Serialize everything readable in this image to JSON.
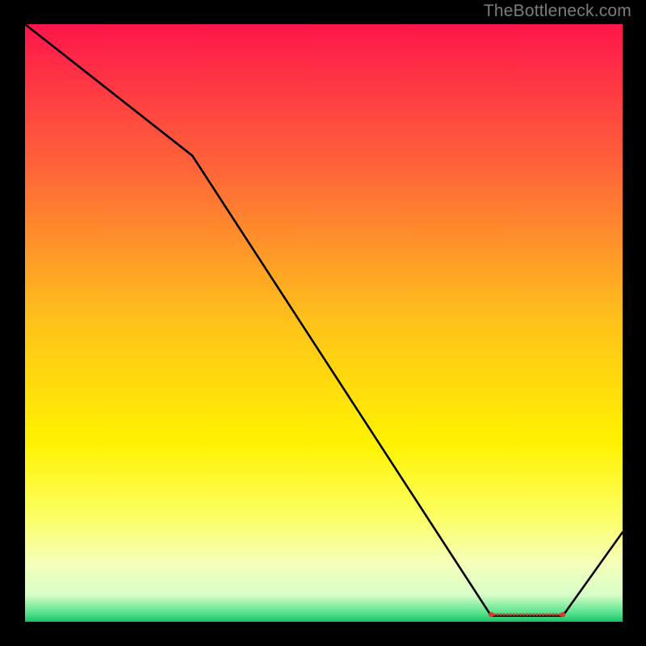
{
  "watermark": "TheBottleneck.com",
  "chart_data": {
    "type": "line",
    "title": "",
    "xlabel": "",
    "ylabel": "",
    "xlim": [
      0,
      100
    ],
    "ylim": [
      0,
      100
    ],
    "x": [
      0,
      28,
      78,
      90,
      100
    ],
    "values": [
      100,
      78,
      1,
      1,
      15
    ],
    "background_gradient": {
      "stops": [
        {
          "offset": 0.0,
          "color": "#ff154b"
        },
        {
          "offset": 0.25,
          "color": "#ff6838"
        },
        {
          "offset": 0.5,
          "color": "#ffc31a"
        },
        {
          "offset": 0.7,
          "color": "#fff200"
        },
        {
          "offset": 0.82,
          "color": "#fcff60"
        },
        {
          "offset": 0.9,
          "color": "#f6ffb8"
        },
        {
          "offset": 0.955,
          "color": "#d8ffc8"
        },
        {
          "offset": 0.985,
          "color": "#58e28e"
        },
        {
          "offset": 1.0,
          "color": "#17c267"
        }
      ]
    },
    "marker_track": {
      "y": 1.2,
      "x_start": 78,
      "x_end": 90,
      "color": "#de3a2e"
    }
  }
}
